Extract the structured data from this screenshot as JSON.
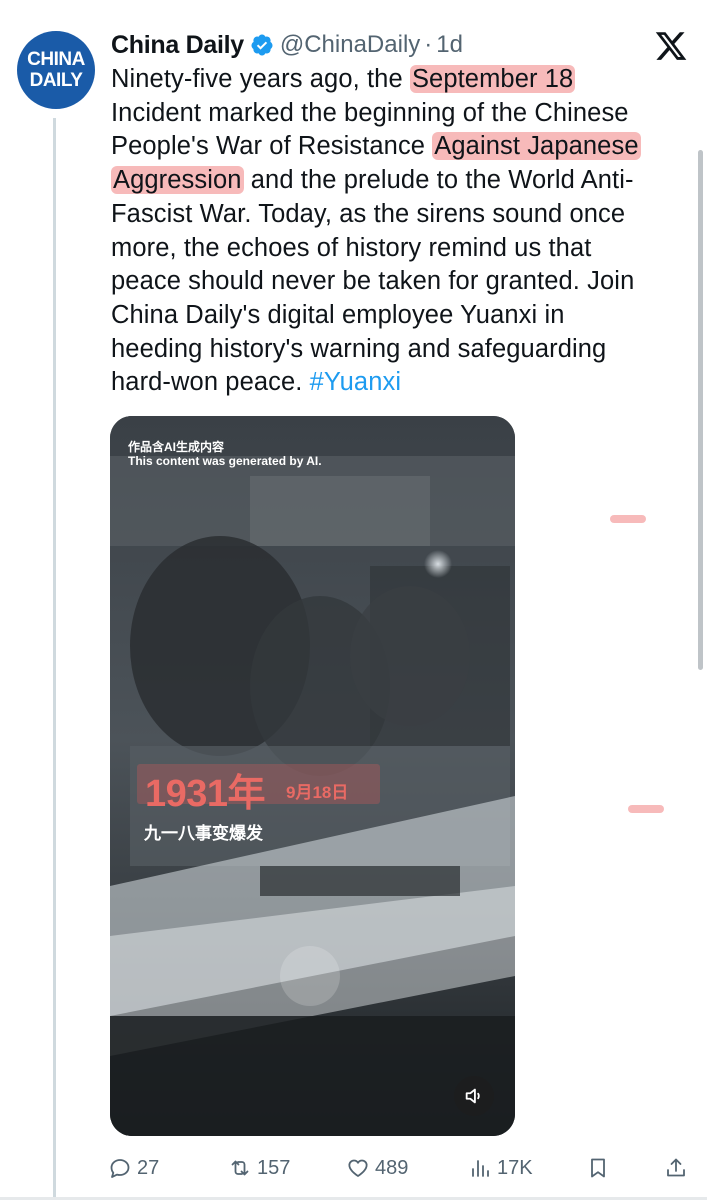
{
  "tweet": {
    "display_name": "China Daily",
    "handle": "@ChinaDaily",
    "separator": "·",
    "time": "1d",
    "avatar_text": [
      "CHINA",
      "DAILY"
    ],
    "text": {
      "part1": "Ninety-five years ago, the ",
      "highlight1": "September 18",
      "part2": "\nIncident marked the beginning of the Chinese\nPeople's War of Resistance ",
      "highlight2": "Against Japanese",
      "part3": "\n",
      "highlight3": "Aggression",
      "part4": " and the prelude to the World Anti-\nFascist War. Today, as the sirens sound once\nmore, the echoes of history remind us that\npeace should never be taken for granted. Join\nChina Daily's digital employee Yuanxi in\nheeding history's warning and safeguarding\nhard-won peace. ",
      "hashtag": "#Yuanxi"
    }
  },
  "media": {
    "ai_notice_cn": "作品含AI生成内容",
    "ai_notice_en": "This content was generated by AI.",
    "year": "1931年",
    "month_day": "9月18日",
    "event": "九一八事变爆发",
    "sound_icon": "volume-muted-icon"
  },
  "actions": {
    "replies": "27",
    "reposts": "157",
    "likes": "489",
    "views": "17K"
  },
  "colors": {
    "link": "#1d9bf0",
    "secondary_text": "#536471",
    "verified": "#1d9bf0",
    "highlight": "#f08282",
    "media_date": "#e96a64"
  }
}
